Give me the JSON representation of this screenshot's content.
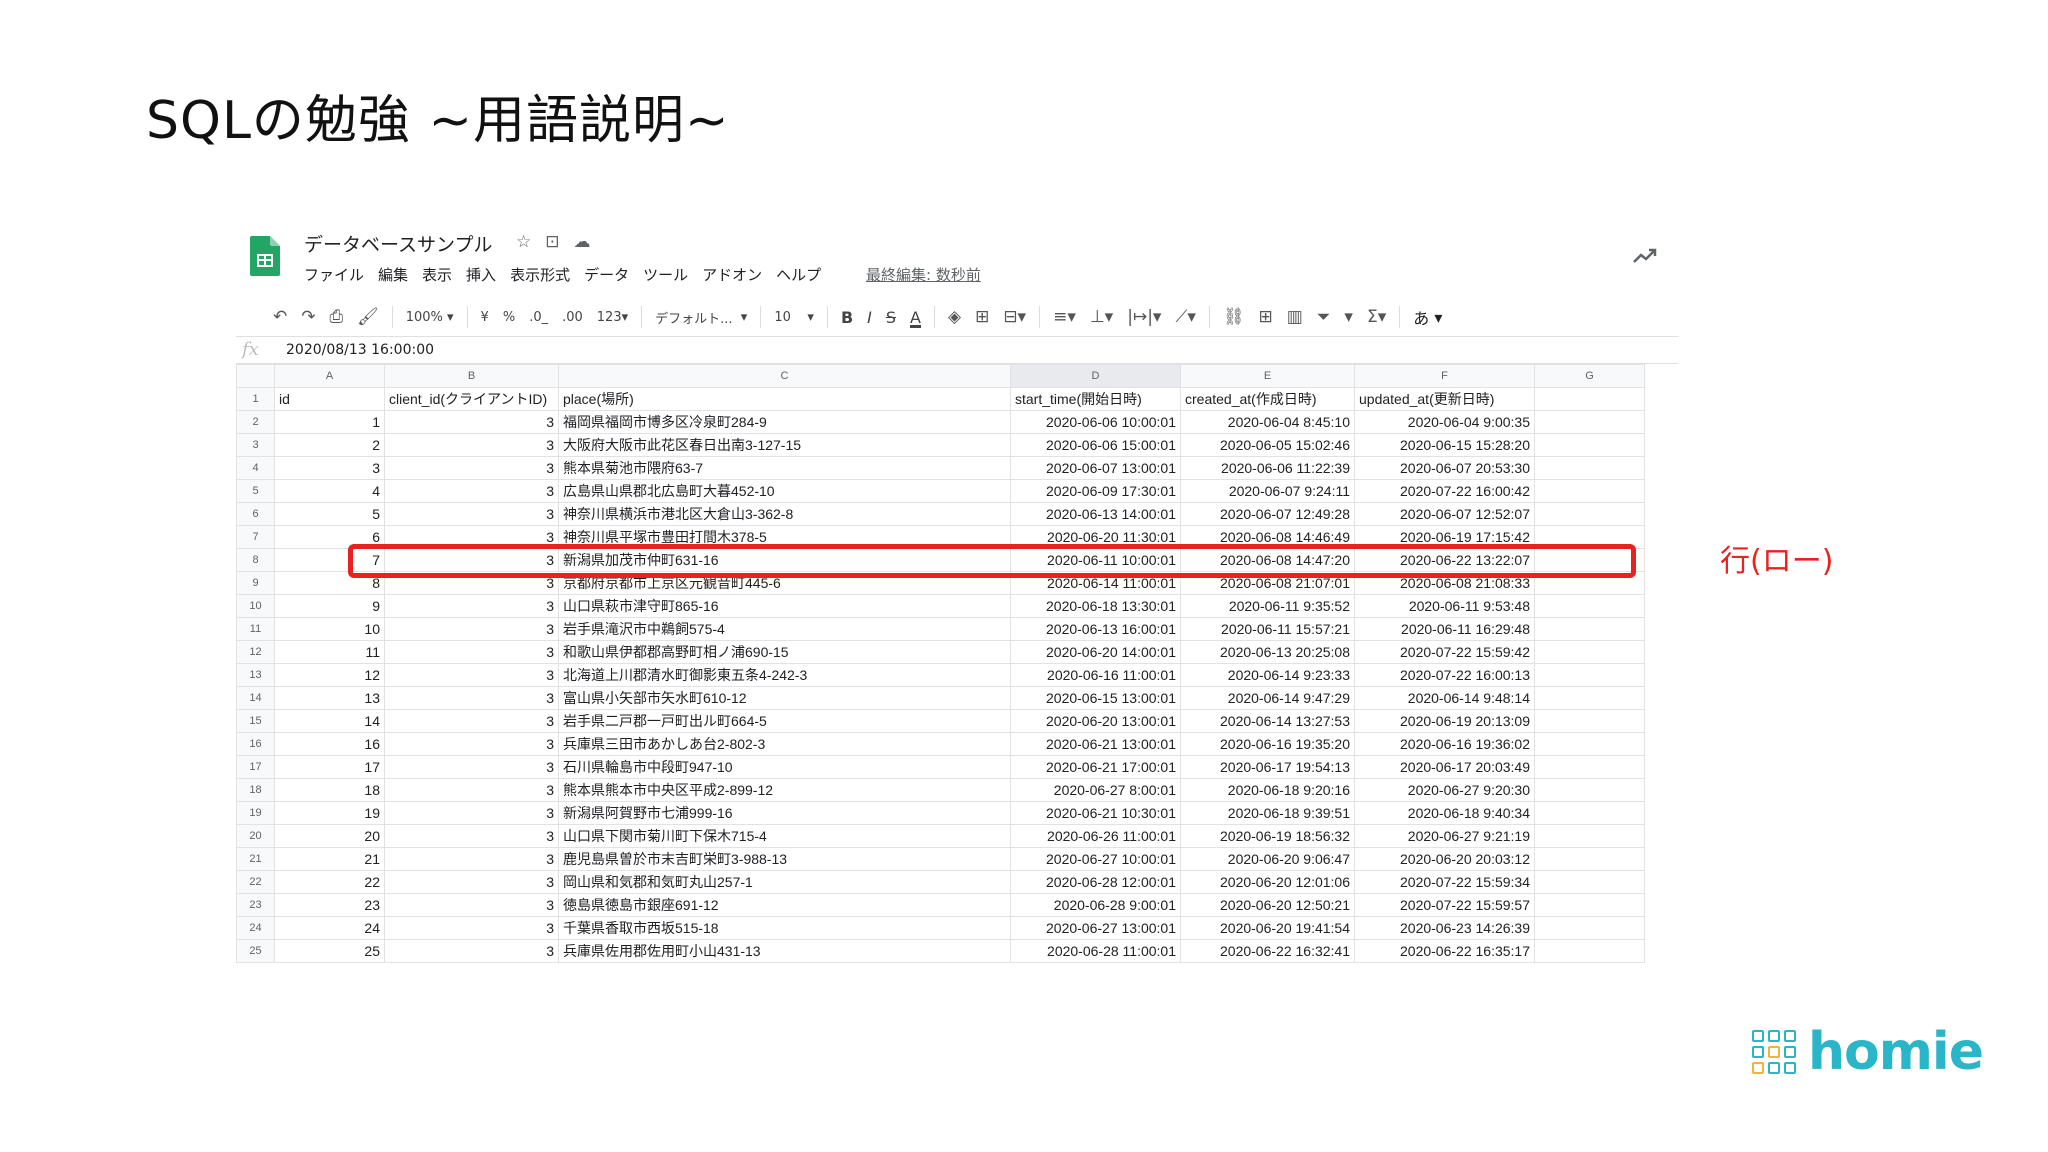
{
  "slide": {
    "title": "SQLの勉強 ~用語説明~",
    "annotation_label": "行(ロー)",
    "annotation_color": "#e8221f",
    "brand": "homie",
    "brand_color": "#2bb5c9"
  },
  "app": {
    "doc_title": "データベースサンプル",
    "title_icons": [
      "star-icon",
      "move-to-folder-icon",
      "cloud-status-icon"
    ],
    "menu": [
      "ファイル",
      "編集",
      "表示",
      "挿入",
      "表示形式",
      "データ",
      "ツール",
      "アドオン",
      "ヘルプ"
    ],
    "last_edit": "最終編集: 数秒前",
    "toolbar": {
      "zoom": "100%",
      "currency": "¥",
      "percent": "%",
      "decimal_decrease": ".0_",
      "decimal_increase": ".00",
      "number_format": "123",
      "font": "デフォルト...",
      "font_size": "10",
      "bold": "B",
      "italic": "I",
      "strike": "S",
      "text_color": "A",
      "input_tools": "あ"
    },
    "formula_bar": {
      "fx": "fx",
      "value": "2020/08/13 16:00:00"
    }
  },
  "sheet": {
    "column_letters": [
      "A",
      "B",
      "C",
      "D",
      "E",
      "F",
      "G"
    ],
    "header_row": [
      "id",
      "client_id(クライアントID)",
      "place(場所)",
      "start_time(開始日時)",
      "created_at(作成日時)",
      "updated_at(更新日時)",
      ""
    ],
    "rows": [
      [
        "1",
        "3",
        "福岡県福岡市博多区冷泉町284-9",
        "2020-06-06 10:00:01",
        "2020-06-04 8:45:10",
        "2020-06-04 9:00:35"
      ],
      [
        "2",
        "3",
        "大阪府大阪市此花区春日出南3-127-15",
        "2020-06-06 15:00:01",
        "2020-06-05 15:02:46",
        "2020-06-15 15:28:20"
      ],
      [
        "3",
        "3",
        "熊本県菊池市隈府63-7",
        "2020-06-07 13:00:01",
        "2020-06-06 11:22:39",
        "2020-06-07 20:53:30"
      ],
      [
        "4",
        "3",
        "広島県山県郡北広島町大暮452-10",
        "2020-06-09 17:30:01",
        "2020-06-07 9:24:11",
        "2020-07-22 16:00:42"
      ],
      [
        "5",
        "3",
        "神奈川県横浜市港北区大倉山3-362-8",
        "2020-06-13 14:00:01",
        "2020-06-07 12:49:28",
        "2020-06-07 12:52:07"
      ],
      [
        "6",
        "3",
        "神奈川県平塚市豊田打間木378-5",
        "2020-06-20 11:30:01",
        "2020-06-08 14:46:49",
        "2020-06-19 17:15:42"
      ],
      [
        "7",
        "3",
        "新潟県加茂市仲町631-16",
        "2020-06-11 10:00:01",
        "2020-06-08 14:47:20",
        "2020-06-22 13:22:07"
      ],
      [
        "8",
        "3",
        "京都府京都市上京区元観音町445-6",
        "2020-06-14 11:00:01",
        "2020-06-08 21:07:01",
        "2020-06-08 21:08:33"
      ],
      [
        "9",
        "3",
        "山口県萩市津守町865-16",
        "2020-06-18 13:30:01",
        "2020-06-11 9:35:52",
        "2020-06-11 9:53:48"
      ],
      [
        "10",
        "3",
        "岩手県滝沢市中鵜飼575-4",
        "2020-06-13 16:00:01",
        "2020-06-11 15:57:21",
        "2020-06-11 16:29:48"
      ],
      [
        "11",
        "3",
        "和歌山県伊都郡高野町相ノ浦690-15",
        "2020-06-20 14:00:01",
        "2020-06-13 20:25:08",
        "2020-07-22 15:59:42"
      ],
      [
        "12",
        "3",
        "北海道上川郡清水町御影東五条4-242-3",
        "2020-06-16 11:00:01",
        "2020-06-14 9:23:33",
        "2020-07-22 16:00:13"
      ],
      [
        "13",
        "3",
        "富山県小矢部市矢水町610-12",
        "2020-06-15 13:00:01",
        "2020-06-14 9:47:29",
        "2020-06-14 9:48:14"
      ],
      [
        "14",
        "3",
        "岩手県二戸郡一戸町出ル町664-5",
        "2020-06-20 13:00:01",
        "2020-06-14 13:27:53",
        "2020-06-19 20:13:09"
      ],
      [
        "16",
        "3",
        "兵庫県三田市あかしあ台2-802-3",
        "2020-06-21 13:00:01",
        "2020-06-16 19:35:20",
        "2020-06-16 19:36:02"
      ],
      [
        "17",
        "3",
        "石川県輪島市中段町947-10",
        "2020-06-21 17:00:01",
        "2020-06-17 19:54:13",
        "2020-06-17 20:03:49"
      ],
      [
        "18",
        "3",
        "熊本県熊本市中央区平成2-899-12",
        "2020-06-27 8:00:01",
        "2020-06-18 9:20:16",
        "2020-06-27 9:20:30"
      ],
      [
        "19",
        "3",
        "新潟県阿賀野市七浦999-16",
        "2020-06-21 10:30:01",
        "2020-06-18 9:39:51",
        "2020-06-18 9:40:34"
      ],
      [
        "20",
        "3",
        "山口県下関市菊川町下保木715-4",
        "2020-06-26 11:00:01",
        "2020-06-19 18:56:32",
        "2020-06-27 9:21:19"
      ],
      [
        "21",
        "3",
        "鹿児島県曽於市末吉町栄町3-988-13",
        "2020-06-27 10:00:01",
        "2020-06-20 9:06:47",
        "2020-06-20 20:03:12"
      ],
      [
        "22",
        "3",
        "岡山県和気郡和気町丸山257-1",
        "2020-06-28 12:00:01",
        "2020-06-20 12:01:06",
        "2020-07-22 15:59:34"
      ],
      [
        "23",
        "3",
        "徳島県徳島市銀座691-12",
        "2020-06-28 9:00:01",
        "2020-06-20 12:50:21",
        "2020-07-22 15:59:57"
      ],
      [
        "24",
        "3",
        "千葉県香取市西坂515-18",
        "2020-06-27 13:00:01",
        "2020-06-20 19:41:54",
        "2020-06-23 14:26:39"
      ],
      [
        "25",
        "3",
        "兵庫県佐用郡佐用町小山431-13",
        "2020-06-28 11:00:01",
        "2020-06-22 16:32:41",
        "2020-06-22 16:35:17"
      ]
    ],
    "highlighted_row_number": 8
  }
}
